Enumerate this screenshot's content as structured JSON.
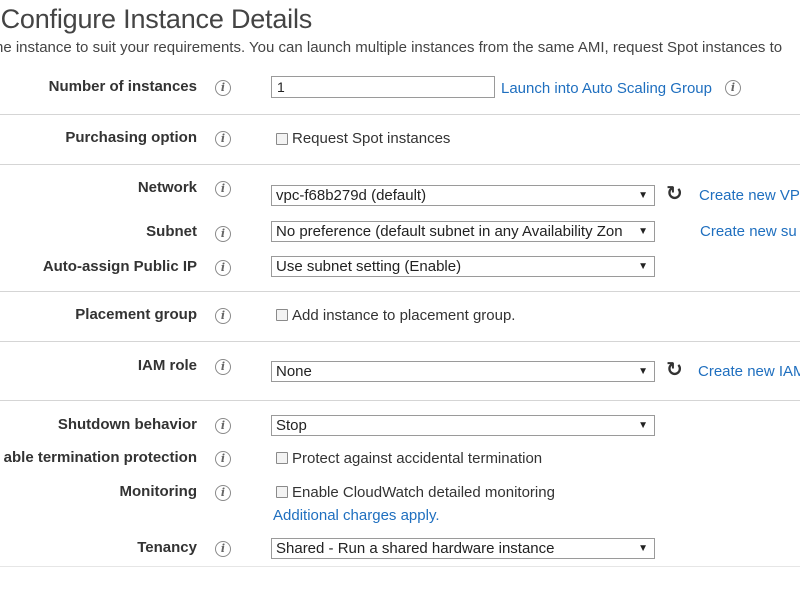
{
  "page": {
    "title": ": Configure Instance Details",
    "subtitle": "he instance to suit your requirements. You can launch multiple instances from the same AMI, request Spot instances to"
  },
  "rows": {
    "num_instances": {
      "label": "Number of instances",
      "value": "1",
      "link": "Launch into Auto Scaling Group"
    },
    "purchasing": {
      "label": "Purchasing option",
      "checkbox": "Request Spot instances"
    },
    "network": {
      "label": "Network",
      "value": "vpc-f68b279d (default)",
      "link": "Create new VP"
    },
    "subnet": {
      "label": "Subnet",
      "value": "No preference (default subnet in any Availability Zon",
      "link": "Create new su"
    },
    "public_ip": {
      "label": "Auto-assign Public IP",
      "value": "Use subnet setting (Enable)"
    },
    "placement": {
      "label": "Placement group",
      "checkbox": "Add instance to placement group."
    },
    "iam": {
      "label": "IAM role",
      "value": "None",
      "link": "Create new IAM"
    },
    "shutdown": {
      "label": "Shutdown behavior",
      "value": "Stop"
    },
    "termination": {
      "label": "able termination protection",
      "checkbox": "Protect against accidental termination"
    },
    "monitoring": {
      "label": "Monitoring",
      "checkbox": "Enable CloudWatch detailed monitoring",
      "link": "Additional charges apply."
    },
    "tenancy": {
      "label": "Tenancy",
      "value": "Shared - Run a shared hardware instance"
    }
  },
  "icons": {
    "info": "i",
    "caret": "▼",
    "refresh": "↻"
  },
  "colors": {
    "link": "#1f6fbf",
    "divider": "#d5d5d5"
  }
}
